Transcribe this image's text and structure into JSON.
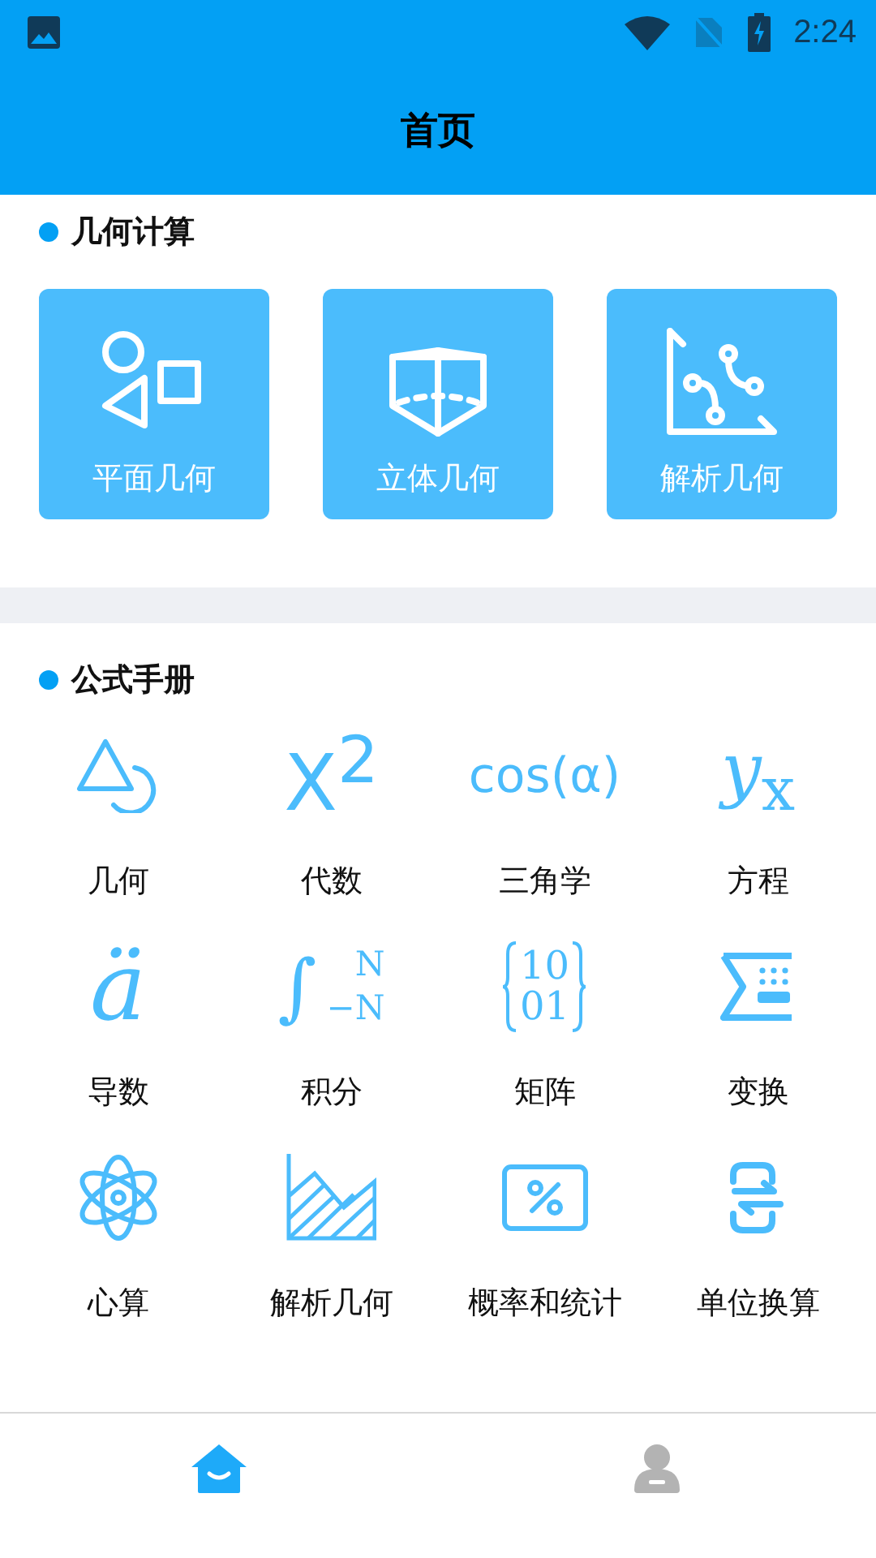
{
  "status_bar": {
    "time": "2:24"
  },
  "header": {
    "title": "首页"
  },
  "geometry_section": {
    "title": "几何计算",
    "cards": [
      {
        "kind": "plane",
        "label": "平面几何"
      },
      {
        "kind": "solid",
        "label": "立体几何"
      },
      {
        "kind": "analytic",
        "label": "解析几何"
      }
    ]
  },
  "formula_section": {
    "title": "公式手册",
    "items": [
      {
        "kind": "shapes",
        "label": "几何"
      },
      {
        "kind": "glyph",
        "glyph": "X$^{2}$",
        "label": "代数"
      },
      {
        "kind": "glyph",
        "glyph": "cos(α)",
        "label": "三角学"
      },
      {
        "kind": "glyph",
        "glyph": "*y*$_{x}$",
        "label": "方程"
      },
      {
        "kind": "glyph",
        "glyph": "*ä*",
        "label": "导数"
      },
      {
        "kind": "integral",
        "sign": "∫",
        "upper": "N",
        "lower": "−N",
        "label": "积分"
      },
      {
        "kind": "matrix",
        "rows": [
          "10",
          "01"
        ],
        "label": "矩阵"
      },
      {
        "kind": "sigma",
        "label": "变换"
      },
      {
        "kind": "atom",
        "label": "心算"
      },
      {
        "kind": "area",
        "label": "解析几何"
      },
      {
        "kind": "percent",
        "label": "概率和统计"
      },
      {
        "kind": "swap",
        "label": "单位换算"
      }
    ]
  },
  "bottom_nav": [
    {
      "kind": "home",
      "selected": true
    },
    {
      "kind": "profile",
      "selected": false
    }
  ]
}
